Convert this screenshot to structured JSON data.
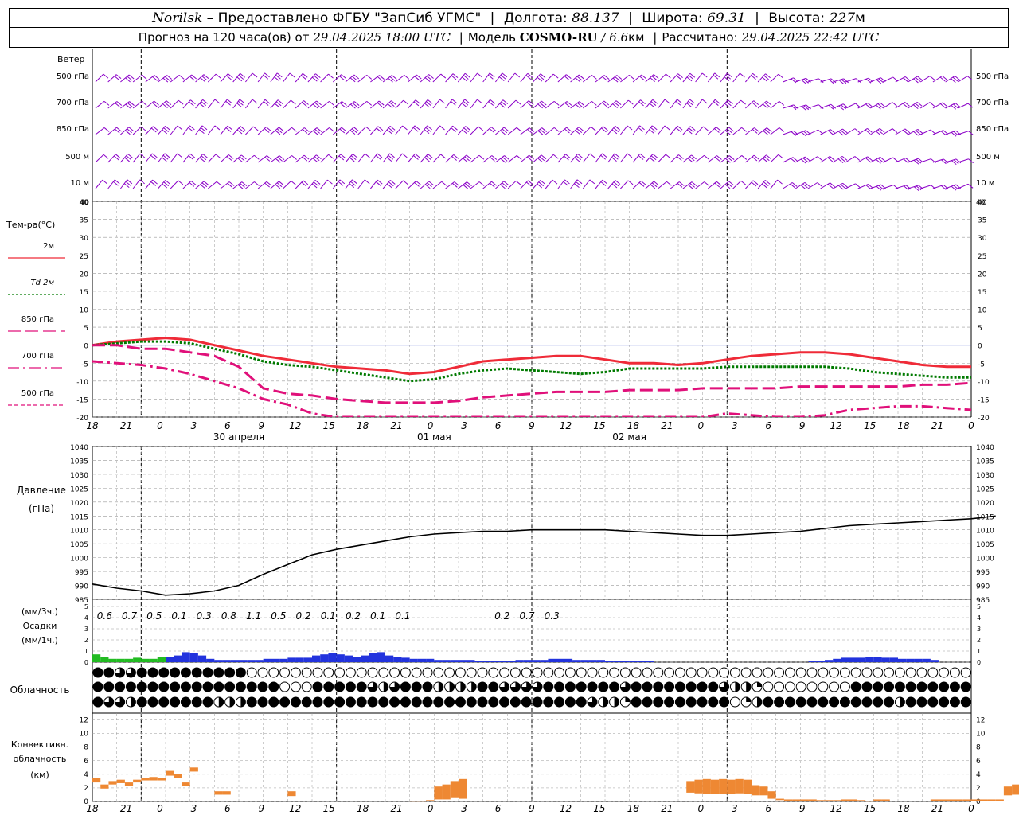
{
  "header": {
    "station": "Norilsk",
    "dash": " – ",
    "provider": "Предоставлено ФГБУ \"ЗапСиб УГМС\"",
    "lon_label": "Долгота:",
    "lon_value": "88.137",
    "lat_label": "Широта:",
    "lat_value": "69.31",
    "alt_label": "Высота:",
    "alt_value": "227",
    "alt_unit": "м",
    "forecast_label": "Прогноз на 120 часа(ов) от",
    "forecast_time": "29.04.2025 18:00 UTC",
    "model_label": "Модель",
    "model_name": "COSMO-RU",
    "model_sep": " / ",
    "model_res": "6.6",
    "model_res_unit": "км",
    "calc_label": "Рассчитано:",
    "calc_time": "29.04.2025 22:42 UTC"
  },
  "colors": {
    "wind": "#8b00c8",
    "t2m": "#ef2b38",
    "td2m": "#007a00",
    "t850": "#e0107a",
    "t700": "#e0107a",
    "t500": "#e0107a",
    "zero_line": "#3344cc",
    "pressure": "#000000",
    "precip_low": "#22bb22",
    "precip_high": "#2233dd",
    "conv_cloud": "#ee8833",
    "grid": "#999999"
  },
  "chart_data": {
    "type": "line",
    "time_axis": {
      "start": "29.04.2025 18:00 UTC",
      "step_hours": 3,
      "tick_labels": [
        "18",
        "21",
        "0",
        "3",
        "6",
        "9",
        "12",
        "15",
        "18",
        "21",
        "0",
        "3",
        "6",
        "9",
        "12",
        "15",
        "18",
        "21",
        "0",
        "3",
        "6",
        "9",
        "12",
        "15",
        "18",
        "21",
        "0"
      ],
      "day_labels": [
        "30 апреля",
        "01 мая",
        "02 мая"
      ]
    },
    "wind_panel": {
      "title": "Ветер",
      "levels": [
        "500 гПа",
        "700 гПа",
        "850 гПа",
        "500 м",
        "10  м"
      ]
    },
    "temperature": {
      "title": "Тем-ра(°C)",
      "ylim": [
        -20,
        40
      ],
      "ticks": [
        40,
        35,
        30,
        25,
        20,
        15,
        10,
        5,
        0,
        -5,
        -10,
        -15,
        -20
      ],
      "series": [
        {
          "name": "2м",
          "values": [
            0,
            1,
            1.5,
            2,
            1.5,
            0,
            -1.5,
            -3,
            -4,
            -5,
            -6,
            -6.5,
            -7,
            -8,
            -7.5,
            -6,
            -4.5,
            -4,
            -3.5,
            -3,
            -3,
            -4,
            -5,
            -5,
            -5.5,
            -5,
            -4,
            -3,
            -2.5,
            -2,
            -2,
            -2.5,
            -3.5,
            -4.5,
            -5.5,
            -6,
            -6,
            -5
          ]
        },
        {
          "name": "Td 2м",
          "values": [
            0,
            0.5,
            1,
            1,
            0.5,
            -1,
            -2.5,
            -4.5,
            -5.5,
            -6,
            -7,
            -8,
            -9,
            -10,
            -9.5,
            -8,
            -7,
            -6.5,
            -7,
            -7.5,
            -8,
            -7.5,
            -6.5,
            -6.5,
            -6.5,
            -6.5,
            -6,
            -6,
            -6,
            -6,
            -6,
            -6.5,
            -7.5,
            -8,
            -8.5,
            -9,
            -9,
            -8.5
          ]
        },
        {
          "name": "850 гПа",
          "values": [
            0,
            0,
            -1,
            -1,
            -2,
            -3,
            -6,
            -12,
            -13.5,
            -14,
            -15,
            -15.5,
            -16,
            -16,
            -16,
            -15.5,
            -14.5,
            -14,
            -13.5,
            -13,
            -13,
            -13,
            -12.5,
            -12.5,
            -12.5,
            -12,
            -12,
            -12,
            -12,
            -11.5,
            -11.5,
            -11.5,
            -11.5,
            -11.5,
            -11,
            -11,
            -10.5,
            -10
          ]
        },
        {
          "name": "700 гПа",
          "values": [
            -4.5,
            -5,
            -5.5,
            -6.5,
            -8,
            -10,
            -12,
            -15,
            -16.5,
            -19,
            -21,
            -24,
            -25,
            -26,
            -26,
            -25.5,
            -25,
            -24,
            -23,
            -22.5,
            -22,
            -22,
            -21.5,
            -21.5,
            -21,
            -20,
            -19,
            -19.5,
            -20.5,
            -20,
            -19.5,
            -18,
            -17.5,
            -17,
            -17,
            -17.5,
            -18,
            -19
          ]
        },
        {
          "name": "500 гПа",
          "values": []
        }
      ]
    },
    "pressure": {
      "title": "Давление",
      "unit": "(гПа)",
      "ylim": [
        985,
        1040
      ],
      "ticks": [
        1040,
        1035,
        1030,
        1025,
        1020,
        1015,
        1010,
        1005,
        1000,
        995,
        990,
        985
      ],
      "values": [
        990.5,
        989,
        988,
        986.5,
        987,
        988,
        990,
        994,
        997.5,
        1001,
        1003,
        1004.5,
        1006,
        1007.5,
        1008.5,
        1009,
        1009.5,
        1009.5,
        1010,
        1010,
        1010,
        1010,
        1009.5,
        1009,
        1008.5,
        1008,
        1008,
        1008.5,
        1009,
        1009.5,
        1010.5,
        1011.5,
        1012,
        1012.5,
        1013,
        1013.5,
        1014,
        1015
      ]
    },
    "precipitation": {
      "title": "Осадки",
      "unit_top": "(мм/3ч.)",
      "unit_bottom": "(мм/1ч.)",
      "ylim": [
        0,
        5
      ],
      "ticks": [
        5,
        4,
        3,
        2,
        1,
        0
      ],
      "three_hour_totals": [
        "0.6",
        "0.7",
        "0.5",
        "0.1",
        "0.3",
        "0.8",
        "1.1",
        "0.5",
        "0.2",
        "0.1",
        "0.2",
        "0.1",
        "0.1",
        "",
        "",
        "",
        "0.2",
        "0.7",
        "0.3",
        "",
        "",
        "",
        "",
        "",
        "",
        "",
        "",
        ""
      ],
      "hourly": [
        0.7,
        0.5,
        0.3,
        0.3,
        0.3,
        0.4,
        0.3,
        0.3,
        0.5,
        0.5,
        0.6,
        0.9,
        0.8,
        0.6,
        0.3,
        0.2,
        0.2,
        0.2,
        0.2,
        0.2,
        0.2,
        0.3,
        0.3,
        0.3,
        0.4,
        0.4,
        0.4,
        0.6,
        0.7,
        0.8,
        0.7,
        0.6,
        0.5,
        0.6,
        0.8,
        0.9,
        0.6,
        0.5,
        0.4,
        0.3,
        0.3,
        0.3,
        0.2,
        0.2,
        0.2,
        0.2,
        0.2,
        0.1,
        0.1,
        0.1,
        0.1,
        0.1,
        0.2,
        0.2,
        0.2,
        0.2,
        0.3,
        0.3,
        0.3,
        0.2,
        0.2,
        0.2,
        0.2,
        0.1,
        0.1,
        0.1,
        0.1,
        0.1,
        0.1,
        0,
        0,
        0,
        0,
        0,
        0,
        0,
        0,
        0,
        0,
        0,
        0,
        0,
        0,
        0,
        0,
        0,
        0,
        0,
        0.1,
        0.1,
        0.2,
        0.3,
        0.4,
        0.4,
        0.4,
        0.5,
        0.5,
        0.4,
        0.4,
        0.3,
        0.3,
        0.3,
        0.3,
        0.2,
        0,
        0,
        0,
        0,
        0,
        0,
        0,
        0,
        0,
        0,
        0,
        0,
        0,
        0,
        0,
        0,
        0,
        0,
        0,
        0,
        0,
        0,
        0,
        0,
        0,
        0,
        0,
        0,
        0,
        0,
        0,
        0,
        0,
        0,
        0,
        0,
        0,
        0,
        0,
        0,
        0,
        0,
        0,
        0,
        0,
        0,
        0,
        0,
        0,
        0,
        0,
        0,
        0,
        0,
        0,
        0,
        0,
        0,
        0,
        0
      ]
    },
    "cloudiness": {
      "title": "Облачность",
      "rows": {
        "high": [
          8,
          8,
          6,
          6,
          8,
          8,
          8,
          8,
          8,
          8,
          8,
          8,
          8,
          8,
          0,
          0,
          0,
          0,
          0,
          0,
          0,
          0,
          0,
          0,
          0,
          0,
          0,
          0,
          0,
          0,
          0,
          0,
          0,
          0,
          0,
          0,
          0,
          0,
          0,
          0,
          0,
          0,
          0,
          0,
          0,
          0,
          0,
          0,
          0,
          0,
          0,
          0,
          0,
          0,
          0,
          0,
          0,
          0,
          0,
          0,
          0,
          0,
          0,
          0,
          0,
          0,
          0,
          0,
          0,
          0,
          0,
          0,
          0,
          0,
          0,
          0,
          0,
          0,
          0,
          0,
          0,
          0,
          0,
          0,
          0,
          0,
          0,
          0,
          0,
          0,
          0,
          0,
          0,
          0,
          0,
          0,
          0,
          0,
          0,
          0,
          0,
          0,
          0,
          0,
          0,
          0,
          0,
          0,
          0,
          0,
          0,
          0,
          0,
          0,
          0,
          0,
          0,
          0,
          0,
          0,
          0,
          0,
          0
        ],
        "middle": [
          8,
          8,
          8,
          8,
          8,
          8,
          8,
          8,
          8,
          8,
          8,
          8,
          8,
          8,
          8,
          8,
          8,
          0,
          0,
          0,
          8,
          8,
          8,
          8,
          8,
          6,
          4,
          6,
          8,
          8,
          8,
          4,
          4,
          4,
          4,
          8,
          8,
          6,
          6,
          6,
          6,
          8,
          8,
          8,
          8,
          8,
          8,
          8,
          6,
          8,
          8,
          8,
          8,
          8,
          8,
          8,
          8,
          6,
          4,
          4,
          2,
          0,
          0,
          0,
          0,
          0,
          0,
          0,
          0,
          8,
          8,
          8,
          8,
          8,
          8,
          8,
          8,
          8,
          8,
          8,
          8,
          8,
          8,
          8,
          8,
          8,
          8,
          8,
          8,
          8,
          8,
          8,
          8,
          8,
          8,
          8,
          8,
          8,
          2,
          0,
          0,
          0,
          0,
          0,
          0,
          0,
          0,
          0,
          0,
          0,
          0,
          0,
          0,
          0,
          0,
          0,
          0,
          0,
          0,
          0,
          0,
          0,
          0
        ],
        "low": [
          8,
          6,
          6,
          4,
          8,
          8,
          8,
          8,
          8,
          8,
          8,
          4,
          4,
          4,
          8,
          8,
          8,
          8,
          8,
          8,
          8,
          8,
          8,
          8,
          8,
          8,
          8,
          8,
          8,
          8,
          8,
          8,
          8,
          8,
          8,
          8,
          8,
          8,
          8,
          8,
          8,
          8,
          8,
          8,
          8,
          6,
          4,
          4,
          2,
          8,
          8,
          8,
          8,
          8,
          8,
          8,
          8,
          8,
          0,
          2,
          4,
          8,
          8,
          8,
          8,
          8,
          8,
          8,
          8,
          8,
          8,
          8,
          8,
          4,
          8,
          8,
          8,
          8,
          8,
          8,
          8,
          8,
          8,
          8,
          8,
          8,
          8,
          8,
          8,
          8,
          8,
          8,
          8,
          8,
          8,
          8,
          8,
          8,
          2,
          0,
          0,
          0,
          0,
          0,
          0,
          0,
          0,
          0,
          0,
          0,
          0,
          0,
          0,
          0,
          0,
          0,
          0,
          0,
          0,
          0,
          0,
          0
        ]
      }
    },
    "convective_cloud": {
      "title": "Конвективн.",
      "title2": "облачность",
      "unit": "(км)",
      "ylim": [
        0,
        13
      ],
      "ticks": [
        12,
        10,
        8,
        6,
        4,
        2,
        0
      ],
      "tops": [
        3.5,
        2.5,
        3,
        3.2,
        2.8,
        3.2,
        3.5,
        3.6,
        3.5,
        4.5,
        4,
        2.8,
        5,
        0,
        0,
        1.5,
        1.5,
        0,
        0,
        0,
        0,
        0,
        0,
        0,
        1.5,
        0,
        0,
        0,
        0,
        0,
        0,
        0,
        0,
        0,
        0,
        0,
        0,
        0,
        0,
        0.1,
        0.1,
        0.2,
        2.2,
        2.5,
        3,
        3.3,
        0,
        0,
        0,
        0,
        0,
        0,
        0,
        0,
        0,
        0,
        0,
        0,
        0,
        0,
        0,
        0,
        0,
        0,
        0,
        0,
        0,
        0,
        0,
        0,
        0,
        0,
        0,
        3,
        3.2,
        3.3,
        3.2,
        3.3,
        3.2,
        3.3,
        3.2,
        2.4,
        2.2,
        1.5,
        0.4,
        0.3,
        0.3,
        0.3,
        0.3,
        0.2,
        0.2,
        0.2,
        0.3,
        0.3,
        0.2,
        0.1,
        0.3,
        0.3,
        0,
        0,
        0,
        0,
        0,
        0.3,
        0.3,
        0.3,
        0.3,
        0.3,
        0.3,
        0.3,
        0.3,
        0.3,
        2.2,
        2.5,
        1.5,
        0,
        0,
        0,
        0,
        0,
        1.3,
        1.3,
        1.3,
        1.3,
        0,
        0,
        0,
        0,
        0,
        0,
        0,
        0,
        0,
        0,
        0,
        0,
        0,
        0,
        0,
        0
      ],
      "bottoms": [
        2.8,
        1.9,
        2.5,
        2.7,
        2.3,
        2.8,
        3.1,
        3.1,
        3.1,
        3.8,
        3.4,
        2.3,
        4.4,
        0,
        0,
        1,
        1,
        0,
        0,
        0,
        0,
        0,
        0,
        0,
        0.8,
        0,
        0,
        0,
        0,
        0,
        0,
        0,
        0,
        0,
        0,
        0,
        0,
        0,
        0,
        0,
        0,
        0,
        0.3,
        0.3,
        0.5,
        0.4,
        0,
        0,
        0,
        0,
        0,
        0,
        0,
        0,
        0,
        0,
        0,
        0,
        0,
        0,
        0,
        0,
        0,
        0,
        0,
        0,
        0,
        0,
        0,
        0,
        0,
        0,
        0,
        1.3,
        1.2,
        1.1,
        1.1,
        1.1,
        1.1,
        1.2,
        1.1,
        0.9,
        0.9,
        0.4,
        0.2,
        0.1,
        0.1,
        0.1,
        0.1,
        0.1,
        0.1,
        0.1,
        0.1,
        0.1,
        0.1,
        0,
        0.1,
        0.1,
        0,
        0,
        0,
        0,
        0,
        0.1,
        0.1,
        0.1,
        0.1,
        0.1,
        0.1,
        0.1,
        0.1,
        0.1,
        0.9,
        1,
        0.9,
        0,
        0,
        0,
        0,
        0,
        1,
        1,
        1,
        1,
        0,
        0,
        0,
        0,
        0,
        0,
        0,
        0,
        0,
        0,
        0,
        0,
        0,
        0,
        0,
        0
      ]
    }
  }
}
